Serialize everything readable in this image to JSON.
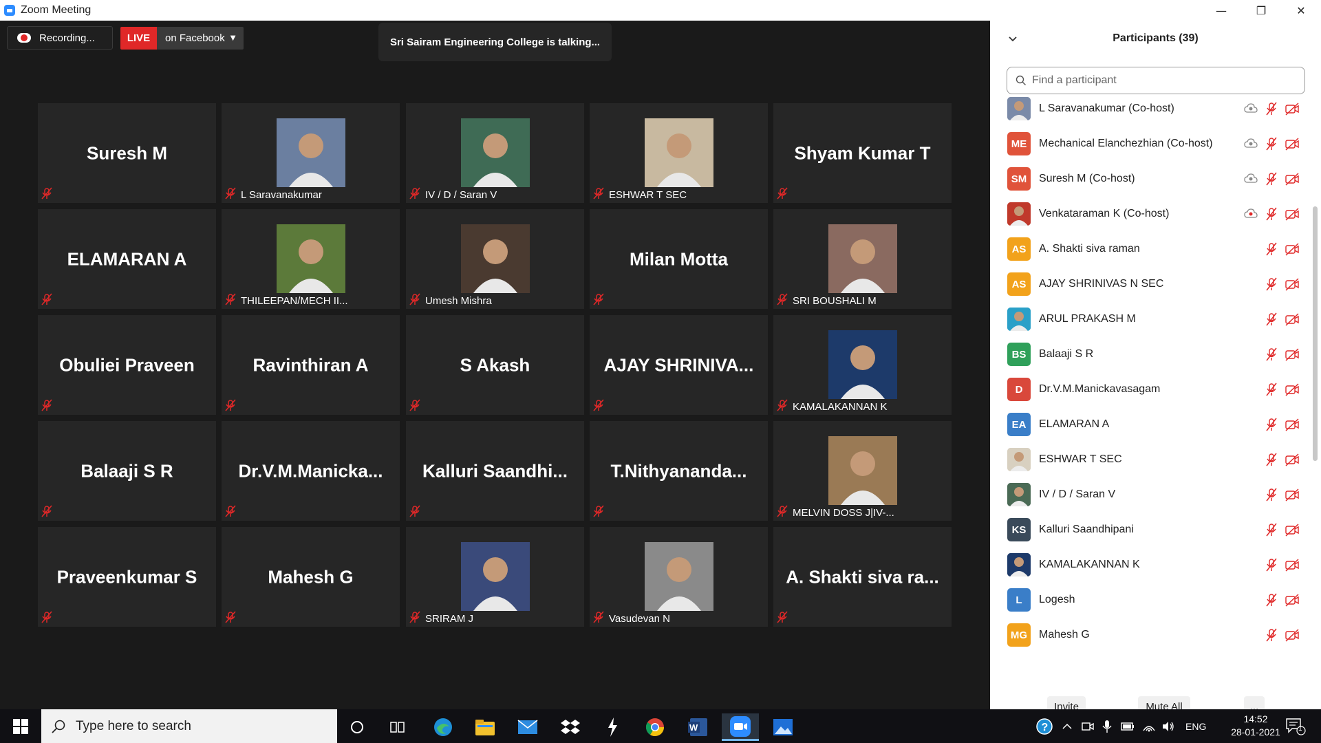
{
  "window": {
    "title": "Zoom Meeting"
  },
  "recording": {
    "label": "Recording..."
  },
  "live": {
    "badge": "LIVE",
    "destination": "on Facebook"
  },
  "speaker_banner": "Sri Sairam Engineering College is talking...",
  "tiles": [
    {
      "name": "Suresh M",
      "label": "",
      "type": "name"
    },
    {
      "name": "",
      "label": "L Saravanakumar",
      "type": "photo",
      "color": "#6b7fa0"
    },
    {
      "name": "",
      "label": "IV / D / Saran V",
      "type": "photo",
      "color": "#3f6b55"
    },
    {
      "name": "",
      "label": "ESHWAR T SEC",
      "type": "photo",
      "color": "#c8b9a0"
    },
    {
      "name": "Shyam Kumar T",
      "label": "",
      "type": "name"
    },
    {
      "name": "ELAMARAN A",
      "label": "",
      "type": "name"
    },
    {
      "name": "",
      "label": "THILEEPAN/MECH II...",
      "type": "photo",
      "color": "#5c7a3a"
    },
    {
      "name": "",
      "label": "Umesh Mishra",
      "type": "photo",
      "color": "#4a3a30"
    },
    {
      "name": "Milan Motta",
      "label": "",
      "type": "name"
    },
    {
      "name": "",
      "label": "SRI BOUSHALI M",
      "type": "photo",
      "color": "#8a6a60"
    },
    {
      "name": "Obuliei Praveen",
      "label": "",
      "type": "name"
    },
    {
      "name": "Ravinthiran A",
      "label": "",
      "type": "name"
    },
    {
      "name": "S Akash",
      "label": "",
      "type": "name"
    },
    {
      "name": "AJAY  SHRINIVA...",
      "label": "",
      "type": "name"
    },
    {
      "name": "",
      "label": "KAMALAKANNAN K",
      "type": "photo",
      "color": "#1d3a6a"
    },
    {
      "name": "Balaaji S R",
      "label": "",
      "type": "name"
    },
    {
      "name": "Dr.V.M.Manicka...",
      "label": "",
      "type": "name"
    },
    {
      "name": "Kalluri  Saandhi...",
      "label": "",
      "type": "name"
    },
    {
      "name": "T.Nithyananda...",
      "label": "",
      "type": "name"
    },
    {
      "name": "",
      "label": "MELVIN DOSS J|IV-...",
      "type": "photo",
      "color": "#9a7a55"
    },
    {
      "name": "Praveenkumar S",
      "label": "",
      "type": "name"
    },
    {
      "name": "Mahesh G",
      "label": "",
      "type": "name"
    },
    {
      "name": "",
      "label": "SRIRAM J",
      "type": "photo",
      "color": "#3a4a7a"
    },
    {
      "name": "",
      "label": "Vasudevan N",
      "type": "photo",
      "color": "#8a8a8a"
    },
    {
      "name": "A. Shakti siva ra...",
      "label": "",
      "type": "name"
    }
  ],
  "participants_panel": {
    "title": "Participants (39)",
    "search_placeholder": "Find a participant",
    "participants": [
      {
        "name": "L Saravanakumar (Co-host)",
        "initials": "",
        "color": "#7a8aa8",
        "photo": true,
        "cohost": true
      },
      {
        "name": "Mechanical Elanchezhian (Co-host)",
        "initials": "ME",
        "color": "#e0533a",
        "photo": false,
        "cohost": true
      },
      {
        "name": "Suresh M (Co-host)",
        "initials": "SM",
        "color": "#e0533a",
        "photo": false,
        "cohost": true
      },
      {
        "name": "Venkataraman K (Co-host)",
        "initials": "",
        "color": "#c0392b",
        "photo": true,
        "cohost": true
      },
      {
        "name": "A. Shakti siva raman",
        "initials": "AS",
        "color": "#f2a21b",
        "photo": false,
        "cohost": false
      },
      {
        "name": "AJAY SHRINIVAS N SEC",
        "initials": "AS",
        "color": "#f2a21b",
        "photo": false,
        "cohost": false
      },
      {
        "name": "ARUL PRAKASH M",
        "initials": "",
        "color": "#2aa0c8",
        "photo": true,
        "cohost": false
      },
      {
        "name": "Balaaji S R",
        "initials": "BS",
        "color": "#2fa05a",
        "photo": false,
        "cohost": false
      },
      {
        "name": "Dr.V.M.Manickavasagam",
        "initials": "D",
        "color": "#d9483b",
        "photo": false,
        "cohost": false
      },
      {
        "name": "ELAMARAN A",
        "initials": "EA",
        "color": "#3a7ec8",
        "photo": false,
        "cohost": false
      },
      {
        "name": "ESHWAR T SEC",
        "initials": "",
        "color": "#d8d0c0",
        "photo": true,
        "cohost": false
      },
      {
        "name": "IV / D / Saran V",
        "initials": "",
        "color": "#4a6a55",
        "photo": true,
        "cohost": false
      },
      {
        "name": "Kalluri Saandhipani",
        "initials": "KS",
        "color": "#3a4a5a",
        "photo": false,
        "cohost": false
      },
      {
        "name": "KAMALAKANNAN K",
        "initials": "",
        "color": "#1d3a6a",
        "photo": true,
        "cohost": false
      },
      {
        "name": "Logesh",
        "initials": "L",
        "color": "#3a7ec8",
        "photo": false,
        "cohost": false
      },
      {
        "name": "Mahesh G",
        "initials": "MG",
        "color": "#f2a21b",
        "photo": false,
        "cohost": false
      }
    ],
    "buttons": {
      "invite": "Invite",
      "mute_all": "Mute All",
      "more": "..."
    }
  },
  "taskbar": {
    "search_placeholder": "Type here to search",
    "language": "ENG",
    "time": "14:52",
    "date": "28-01-2021",
    "notification_count": "1"
  },
  "colors": {
    "live_red": "#e02828",
    "mic_off_red": "#e02828",
    "zoom_blue": "#2d8cff"
  }
}
